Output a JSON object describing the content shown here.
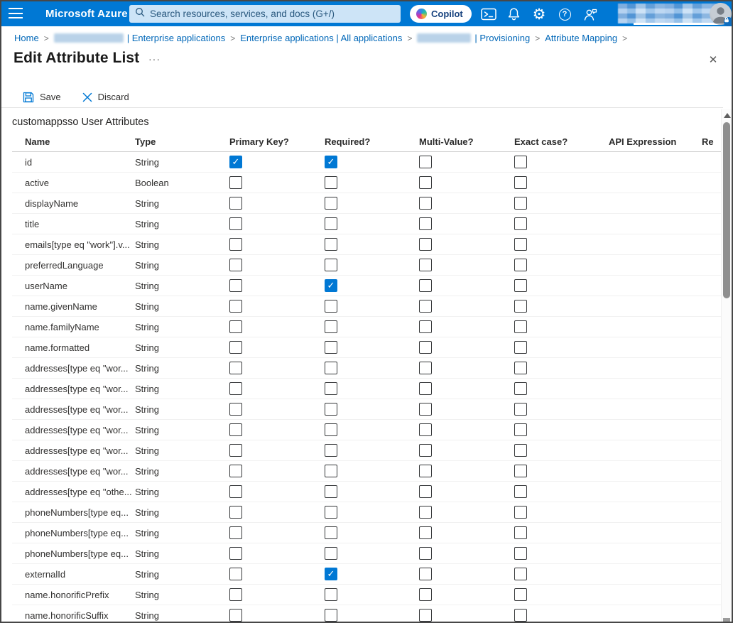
{
  "colors": {
    "topbar": "#0078d4",
    "accent": "#0078d4",
    "checkbox_checked": "#0078d4",
    "breadcrumb_link": "#0067b8",
    "search_bg": "#cde4f7"
  },
  "topbar": {
    "brand": "Microsoft Azure",
    "search_placeholder": "Search resources, services, and docs (G+/)",
    "copilot_label": "Copilot"
  },
  "breadcrumb": {
    "separator": ">",
    "items": [
      {
        "label": "Home"
      },
      {
        "redacted": true,
        "label": "| Enterprise applications"
      },
      {
        "label": "Enterprise applications | All applications"
      },
      {
        "redacted": true,
        "label": "| Provisioning"
      },
      {
        "label": "Attribute Mapping"
      }
    ]
  },
  "page": {
    "title": "Edit Attribute List",
    "more_label": "···",
    "close_label": "✕"
  },
  "toolbar": {
    "save_label": "Save",
    "discard_label": "Discard"
  },
  "content": {
    "section_title": "customappsso User Attributes"
  },
  "table": {
    "headers": [
      "Name",
      "Type",
      "Primary Key?",
      "Required?",
      "Multi-Value?",
      "Exact case?",
      "API Expression",
      "Re"
    ],
    "rows": [
      {
        "name": "id",
        "type": "String",
        "pk": true,
        "req": true,
        "mv": false,
        "ec": false
      },
      {
        "name": "active",
        "type": "Boolean",
        "pk": false,
        "req": false,
        "mv": false,
        "ec": false
      },
      {
        "name": "displayName",
        "type": "String",
        "pk": false,
        "req": false,
        "mv": false,
        "ec": false
      },
      {
        "name": "title",
        "type": "String",
        "pk": false,
        "req": false,
        "mv": false,
        "ec": false
      },
      {
        "name": "emails[type eq \"work\"].v...",
        "type": "String",
        "pk": false,
        "req": false,
        "mv": false,
        "ec": false
      },
      {
        "name": "preferredLanguage",
        "type": "String",
        "pk": false,
        "req": false,
        "mv": false,
        "ec": false
      },
      {
        "name": "userName",
        "type": "String",
        "pk": false,
        "req": true,
        "mv": false,
        "ec": false
      },
      {
        "name": "name.givenName",
        "type": "String",
        "pk": false,
        "req": false,
        "mv": false,
        "ec": false
      },
      {
        "name": "name.familyName",
        "type": "String",
        "pk": false,
        "req": false,
        "mv": false,
        "ec": false
      },
      {
        "name": "name.formatted",
        "type": "String",
        "pk": false,
        "req": false,
        "mv": false,
        "ec": false
      },
      {
        "name": "addresses[type eq \"wor...",
        "type": "String",
        "pk": false,
        "req": false,
        "mv": false,
        "ec": false
      },
      {
        "name": "addresses[type eq \"wor...",
        "type": "String",
        "pk": false,
        "req": false,
        "mv": false,
        "ec": false
      },
      {
        "name": "addresses[type eq \"wor...",
        "type": "String",
        "pk": false,
        "req": false,
        "mv": false,
        "ec": false
      },
      {
        "name": "addresses[type eq \"wor...",
        "type": "String",
        "pk": false,
        "req": false,
        "mv": false,
        "ec": false
      },
      {
        "name": "addresses[type eq \"wor...",
        "type": "String",
        "pk": false,
        "req": false,
        "mv": false,
        "ec": false
      },
      {
        "name": "addresses[type eq \"wor...",
        "type": "String",
        "pk": false,
        "req": false,
        "mv": false,
        "ec": false
      },
      {
        "name": "addresses[type eq \"othe...",
        "type": "String",
        "pk": false,
        "req": false,
        "mv": false,
        "ec": false
      },
      {
        "name": "phoneNumbers[type eq...",
        "type": "String",
        "pk": false,
        "req": false,
        "mv": false,
        "ec": false
      },
      {
        "name": "phoneNumbers[type eq...",
        "type": "String",
        "pk": false,
        "req": false,
        "mv": false,
        "ec": false
      },
      {
        "name": "phoneNumbers[type eq...",
        "type": "String",
        "pk": false,
        "req": false,
        "mv": false,
        "ec": false
      },
      {
        "name": "externalId",
        "type": "String",
        "pk": false,
        "req": true,
        "mv": false,
        "ec": false
      },
      {
        "name": "name.honorificPrefix",
        "type": "String",
        "pk": false,
        "req": false,
        "mv": false,
        "ec": false
      },
      {
        "name": "name.honorificSuffix",
        "type": "String",
        "pk": false,
        "req": false,
        "mv": false,
        "ec": false
      }
    ]
  }
}
